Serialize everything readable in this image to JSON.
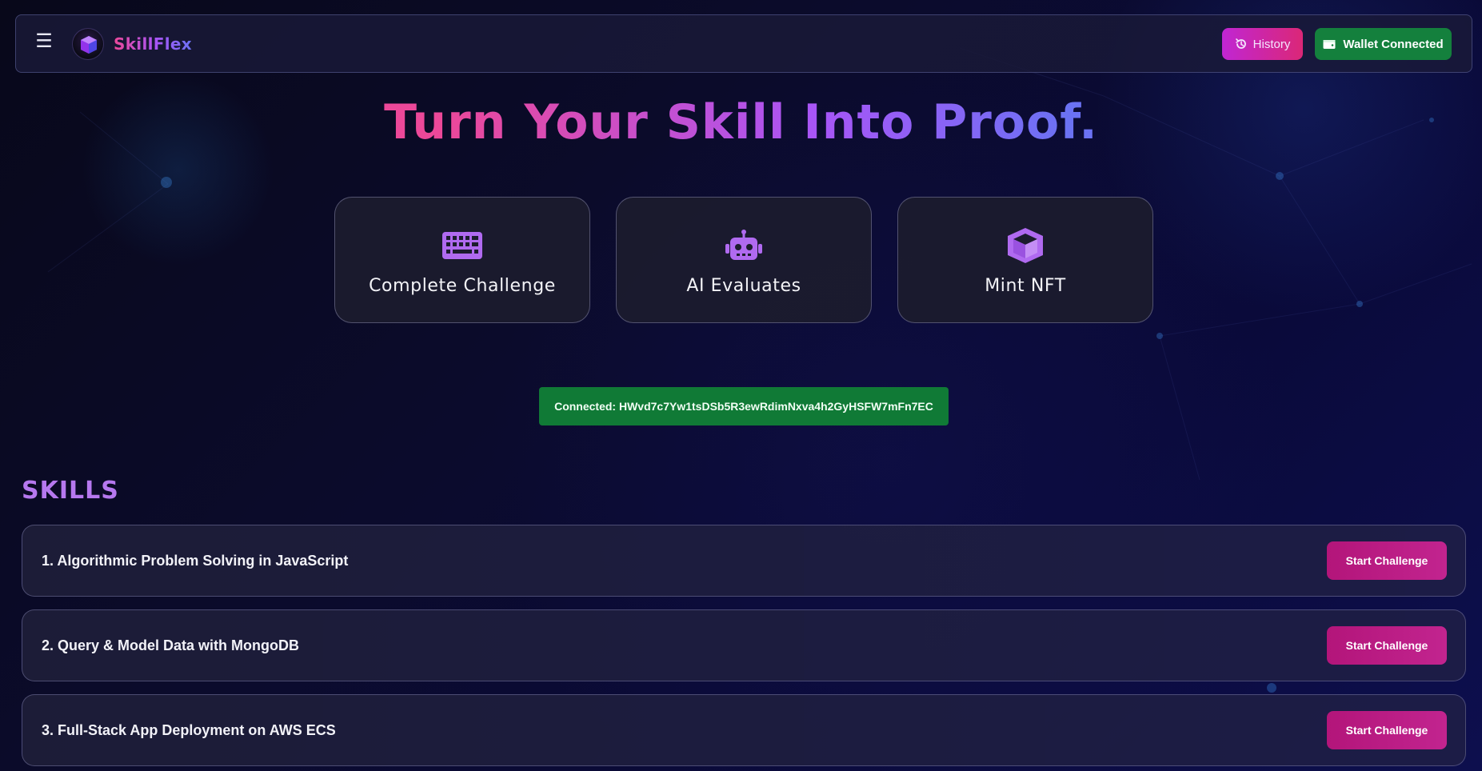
{
  "header": {
    "brand": "SkillFlex",
    "history_label": "History",
    "wallet_label": "Wallet Connected",
    "icons": {
      "menu": "hamburger-icon",
      "logo": "cube-logo",
      "history": "history-icon",
      "wallet": "wallet-icon"
    }
  },
  "hero": {
    "title_parts": [
      "Turn",
      "Your",
      "Skill",
      "Into",
      "Proof."
    ]
  },
  "steps": [
    {
      "label": "Complete Challenge",
      "icon": "keyboard-icon"
    },
    {
      "label": "AI Evaluates",
      "icon": "robot-icon"
    },
    {
      "label": "Mint NFT",
      "icon": "cube-icon"
    }
  ],
  "connection": {
    "text": "Connected: HWvd7c7Yw1tsDSb5R3ewRdimNxva4h2GyHSFW7mFn7EC"
  },
  "skills": {
    "heading": "SKILLS",
    "items": [
      {
        "title": "1. Algorithmic Problem Solving in JavaScript",
        "button": "Start Challenge"
      },
      {
        "title": "2. Query & Model Data with MongoDB",
        "button": "Start Challenge"
      },
      {
        "title": "3. Full-Stack App Deployment on AWS ECS",
        "button": "Start Challenge"
      }
    ]
  },
  "colors": {
    "accent_pink": "#ec4899",
    "accent_purple": "#a855f7",
    "accent_blue": "#6b72f3",
    "success_green": "#14803d",
    "button_magenta": "#b3157a"
  }
}
